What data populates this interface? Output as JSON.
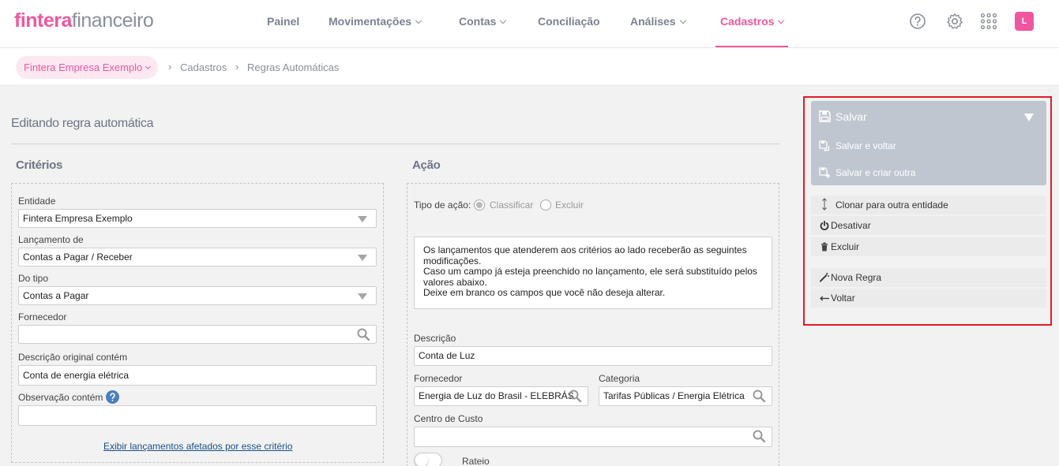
{
  "brand": {
    "name": "fintera",
    "product": "financeiro",
    "accent": "#f0569f"
  },
  "nav": {
    "items": [
      {
        "label": "Painel"
      },
      {
        "label": "Movimentações"
      },
      {
        "label": "Contas"
      },
      {
        "label": "Conciliação"
      },
      {
        "label": "Análises"
      },
      {
        "label": "Cadastros"
      }
    ],
    "active": "Cadastros",
    "icons": [
      "help-icon",
      "gear-icon",
      "apps-grid-icon"
    ],
    "avatar": "L"
  },
  "breadcrumb": {
    "company": "Fintera Empresa Exemplo",
    "items": [
      "Cadastros",
      "Regras Automáticas"
    ]
  },
  "page": {
    "title": "Editando regra automática"
  },
  "criteria": {
    "title": "Critérios",
    "entidade": {
      "label": "Entidade",
      "value": "Fintera Empresa Exemplo"
    },
    "lancamento_de": {
      "label": "Lançamento de",
      "value": "Contas a Pagar / Receber"
    },
    "do_tipo": {
      "label": "Do tipo",
      "value": "Contas a Pagar"
    },
    "fornecedor": {
      "label": "Fornecedor",
      "value": ""
    },
    "descricao_original": {
      "label": "Descrição original contém",
      "value": "Conta de energia elétrica"
    },
    "observacao": {
      "label": "Observação contém",
      "value": ""
    },
    "link": "Exibir lançamentos afetados por esse critério"
  },
  "action": {
    "title": "Ação",
    "tipo_label": "Tipo de ação:",
    "tipo_options": [
      "Classificar",
      "Excluir"
    ],
    "tipo_selected": "Classificar",
    "info": [
      "Os lançamentos que atenderem aos critérios ao lado receberão as seguintes modificações.",
      "Caso um campo já esteja preenchido no lançamento, ele será substituído pelos valores abaixo.",
      "Deixe em branco os campos que você não deseja alterar."
    ],
    "descricao": {
      "label": "Descrição",
      "value": "Conta de Luz"
    },
    "fornecedor": {
      "label": "Fornecedor",
      "value": "Energia de Luz do Brasil - ELEBRÁS"
    },
    "categoria": {
      "label": "Categoria",
      "value": "Tarifas Públicas / Energia Elétrica"
    },
    "centro_custo": {
      "label": "Centro de Custo",
      "value": ""
    },
    "rateio": {
      "label": "Rateio",
      "enabled": false
    }
  },
  "panel": {
    "salvar": "Salvar",
    "salvar_voltar": "Salvar e voltar",
    "salvar_criar": "Salvar e criar outra",
    "clonar": "Clonar para outra entidade",
    "desativar": "Desativar",
    "excluir": "Excluir",
    "nova_regra": "Nova Regra",
    "voltar": "Voltar",
    "highlight_color": "#e01b24"
  }
}
